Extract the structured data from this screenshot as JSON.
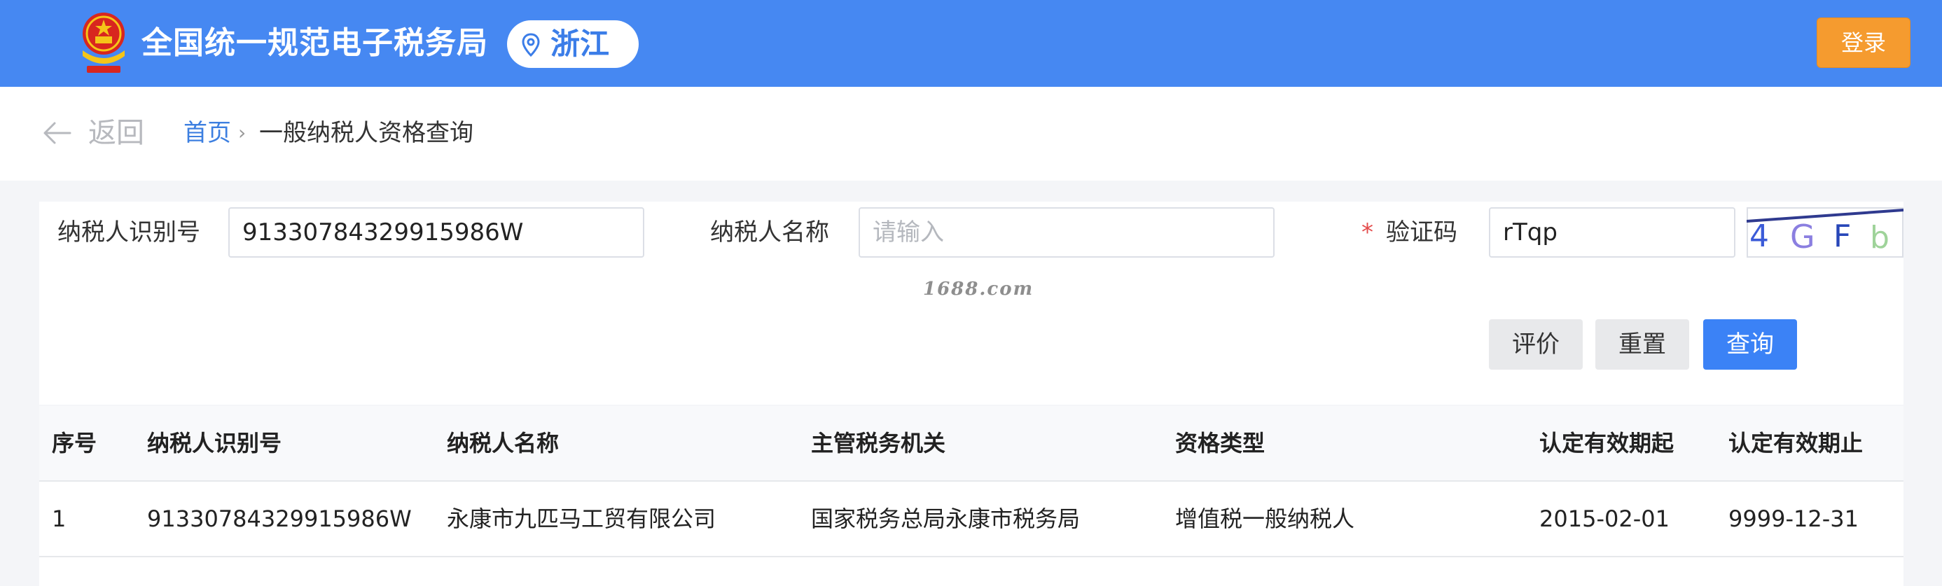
{
  "header": {
    "site_title": "全国统一规范电子税务局",
    "region": "浙江",
    "login_label": "登录"
  },
  "breadcrumb": {
    "back_label": "返回",
    "home_label": "首页",
    "separator": "›",
    "current_label": "一般纳税人资格查询"
  },
  "search_form": {
    "taxpayer_id_label": "纳税人识别号",
    "taxpayer_id_value": "91330784329915986W",
    "taxpayer_name_label": "纳税人名称",
    "taxpayer_name_placeholder": "请输入",
    "captcha_required_mark": "*",
    "captcha_label": "验证码",
    "captcha_value": "rTqp",
    "captcha_image_text": "4GFb",
    "watermark": "1688.com"
  },
  "actions": {
    "evaluate_label": "评价",
    "reset_label": "重置",
    "query_label": "查询"
  },
  "table": {
    "columns": [
      "序号",
      "纳税人识别号",
      "纳税人名称",
      "主管税务机关",
      "资格类型",
      "认定有效期起",
      "认定有效期止"
    ],
    "rows": [
      [
        "1",
        "91330784329915986W",
        "永康市九匹马工贸有限公司",
        "国家税务总局永康市税务局",
        "增值税一般纳税人",
        "2015-02-01",
        "9999-12-31"
      ]
    ]
  },
  "icons": {
    "emblem": "national-emblem-icon",
    "location": "location-pin-icon",
    "back": "back-arrow-icon"
  },
  "colors": {
    "header_bg": "#4688f2",
    "login_bg": "#f59b2f",
    "primary": "#3b82f6",
    "link": "#3d7fe0"
  }
}
